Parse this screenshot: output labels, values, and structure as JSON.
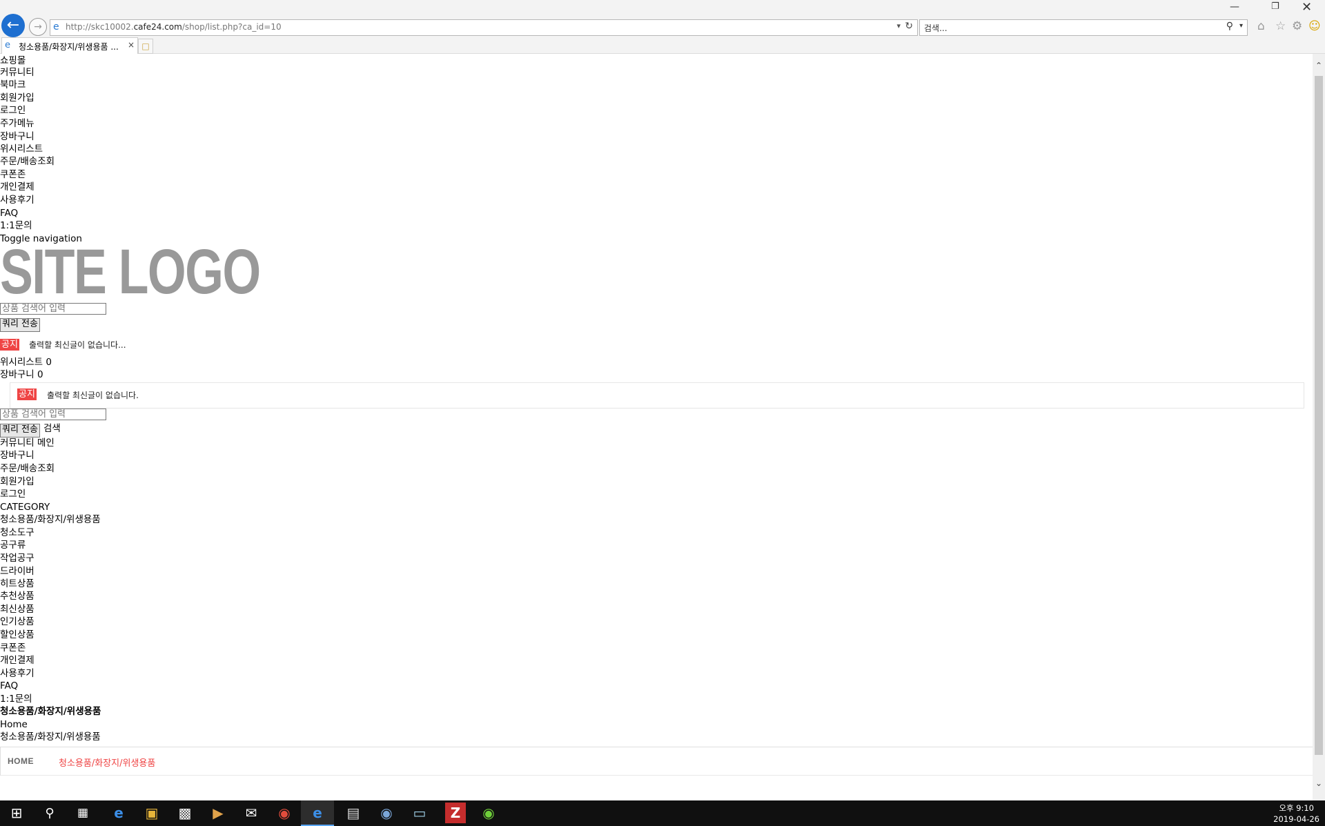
{
  "browser": {
    "url_prefix": "http://skc10002.",
    "url_domain": "cafe24.com",
    "url_path": "/shop/list.php?ca_id=10",
    "search_placeholder": "검색...",
    "tab_title": "청소용품/화장지/위생용품 ...",
    "tab_close": "×"
  },
  "page": {
    "top_menu": [
      "쇼핑몰",
      "커뮤니티",
      "북마크",
      "회원가입",
      "로그인",
      "주가메뉴",
      "장바구니",
      "위시리스트",
      "주문/배송조회",
      "쿠폰존",
      "개인결제",
      "사용후기",
      "FAQ",
      "1:1문의"
    ],
    "toggle_nav": "Toggle navigation",
    "logo": "SITE LOGO",
    "search_placeholder": "상품 검색어 입력",
    "submit_label": "쿼리 전송",
    "notice_badge": "공지",
    "notice_text": "출력할 최신글이 없습니다...",
    "wishlist_label": "위시리스트 0",
    "cart_label": "장바구니 0",
    "notice2_text": "출력할 최신글이 없습니다.",
    "search2_suffix": "검색",
    "mobile_menu": [
      "커뮤니티 메인",
      "장바구니",
      "주문/배송조회",
      "회원가입",
      "로그인"
    ],
    "category_heading": "CATEGORY",
    "category_items": [
      "청소용품/화장지/위생용품",
      "청소도구",
      "공구류",
      "작업공구",
      "드라이버",
      "히트상품",
      "추천상품",
      "최신상품",
      "인기상품",
      "할인상품",
      "쿠폰존",
      "개인결제",
      "사용후기",
      "FAQ",
      "1:1문의"
    ],
    "page_title": "청소용품/화장지/위생용품",
    "home_link": "Home",
    "current_cat": "청소용품/화장지/위생용품",
    "crumb_home": "HOME",
    "crumb_current": "청소용품/화장지/위생용품"
  },
  "taskbar": {
    "time": "오후 9:10",
    "date": "2019-04-26"
  },
  "colors": {
    "accent_red": "#ef4444",
    "logo_gray": "#999999",
    "ie_blue": "#1e6fd0"
  }
}
